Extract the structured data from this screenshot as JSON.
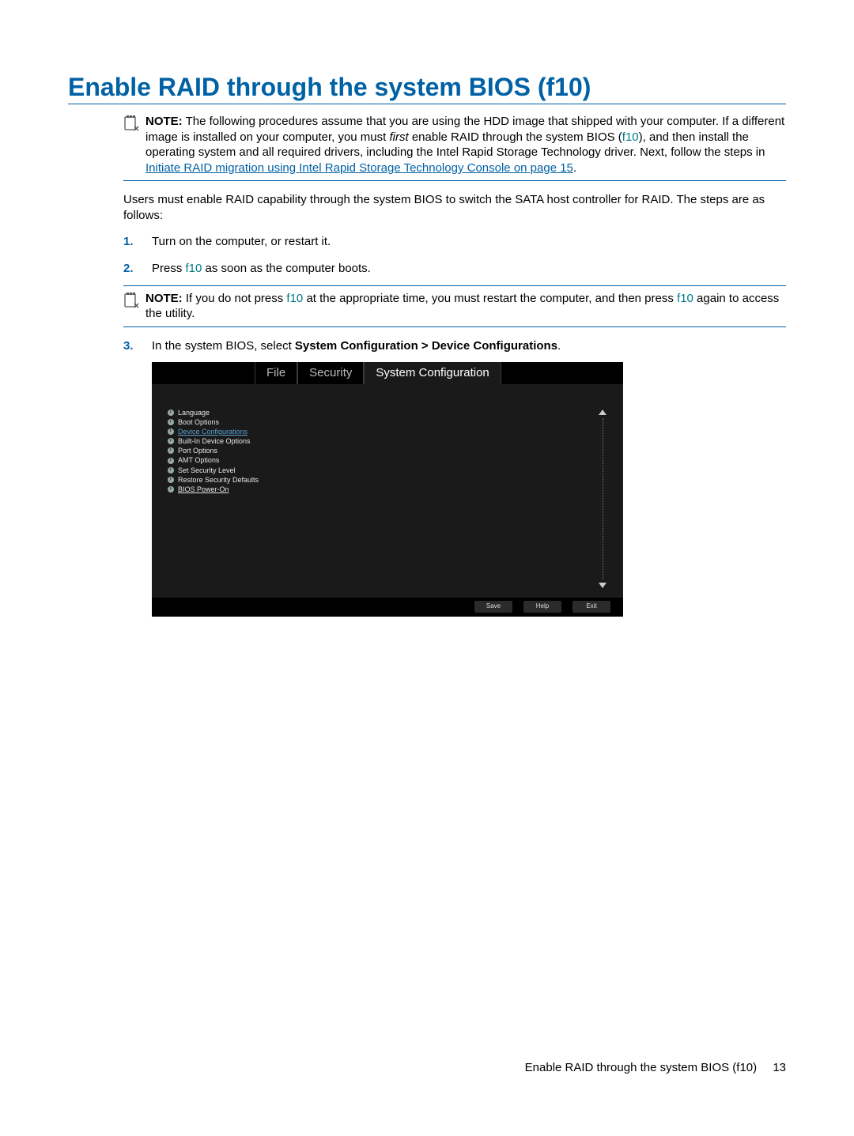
{
  "title": "Enable RAID through the system BIOS (f10)",
  "note1": {
    "label": "NOTE:",
    "t1": "The following procedures assume that you are using the HDD image that shipped with your computer. If a different image is installed on your computer, you must ",
    "first": "first",
    "t2": " enable RAID through the system BIOS (",
    "f10a": "f10",
    "t3": "), and then install the operating system and all required drivers, including the Intel Rapid Storage Technology driver. Next, follow the steps in ",
    "link": "Initiate RAID migration using Intel Rapid Storage Technology Console on page 15",
    "t4": "."
  },
  "intro": "Users must enable RAID capability through the system BIOS to switch the SATA host controller for RAID. The steps are as follows:",
  "steps": {
    "s1": {
      "num": "1.",
      "text": "Turn on the computer, or restart it."
    },
    "s2": {
      "num": "2.",
      "pre": "Press ",
      "f10": "f10",
      "post": " as soon as the computer boots."
    },
    "note2": {
      "label": "NOTE:",
      "t1": "If you do not press ",
      "f10a": "f10",
      "t2": " at the appropriate time, you must restart the computer, and then press ",
      "f10b": "f10",
      "t3": " again to access the utility."
    },
    "s3": {
      "num": "3.",
      "pre": "In the system BIOS, select ",
      "bold": "System Configuration > Device Configurations",
      "post": "."
    }
  },
  "bios": {
    "tabs": {
      "file": "File",
      "security": "Security",
      "sysconf": "System Configuration"
    },
    "menu": [
      "Language",
      "Boot Options",
      "Device Configurations",
      "Built-In Device Options",
      "Port Options",
      "AMT Options",
      "Set Security Level",
      "Restore Security Defaults",
      "BIOS Power-On"
    ],
    "buttons": {
      "save": "Save",
      "help": "Help",
      "exit": "Exit"
    }
  },
  "footer": {
    "text": "Enable RAID through the system BIOS (f10)",
    "page": "13"
  }
}
